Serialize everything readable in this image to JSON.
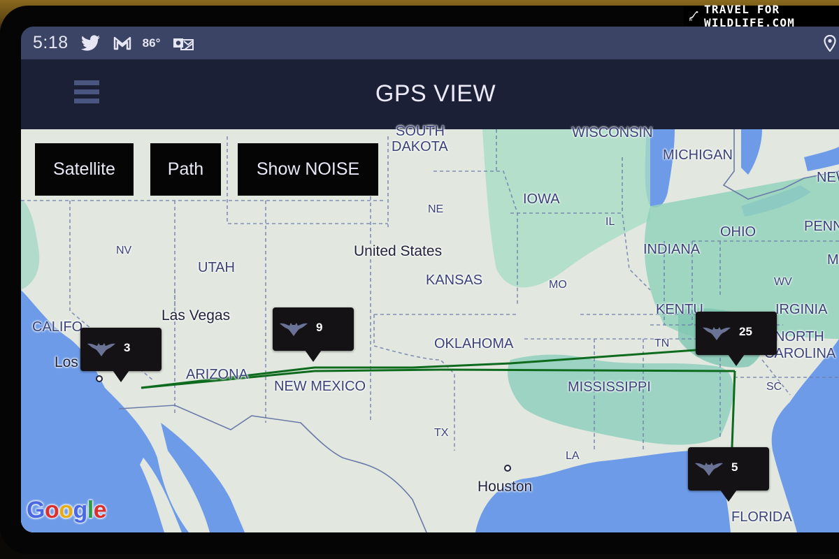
{
  "watermark": {
    "text": "TRAVEL FOR WILDLIFE.COM",
    "icon": "giraffe-icon"
  },
  "statusbar": {
    "time": "5:18",
    "temperature": "86°",
    "icons": [
      "twitter-icon",
      "gmail-icon",
      "outlook-icon",
      "location-icon"
    ]
  },
  "appbar": {
    "title": "GPS VIEW",
    "menu_icon": "hamburger-menu-icon"
  },
  "map": {
    "buttons": [
      {
        "label": "Satellite"
      },
      {
        "label": "Path"
      },
      {
        "label": "Show NOISE"
      }
    ],
    "labels": {
      "south": "SOUTH",
      "dakota": "DAKOTA",
      "wisconsin": "WISCONSIN",
      "michigan": "MICHIGAN",
      "new": "NEW",
      "iowa": "IOWA",
      "ne": "NE",
      "il": "IL",
      "ohio": "OHIO",
      "penn": "PENN",
      "m": "M",
      "nv": "NV",
      "utah": "UTAH",
      "united_states": "United States",
      "indiana": "INDIANA",
      "kansas": "KANSAS",
      "mo": "MO",
      "wv": "WV",
      "kentu": "KENTU",
      "virginia": "IRGINIA",
      "las_vegas": "Las Vegas",
      "califo": "CALIFO",
      "oklahoma": "OKLAHOMA",
      "tn": "TN",
      "north": "NORTH",
      "carolina": "CAROLINA",
      "los_angeles": "Los Angeles",
      "arizona": "ARIZONA",
      "new_mexico": "NEW MEXICO",
      "mississippi": "MISSISSIPPI",
      "sc": "SC",
      "tx": "TX",
      "la": "LA",
      "houston": "Houston",
      "florida": "FLORIDA"
    },
    "markers": [
      {
        "name": "marker-los-angeles",
        "count": "3"
      },
      {
        "name": "marker-new-mexico",
        "count": "9"
      },
      {
        "name": "marker-tennessee",
        "count": "25"
      },
      {
        "name": "marker-florida",
        "count": "5"
      }
    ],
    "path_color": "#0e6b1e",
    "current_location_color": "#5b5ff2",
    "attribution": "Google"
  }
}
